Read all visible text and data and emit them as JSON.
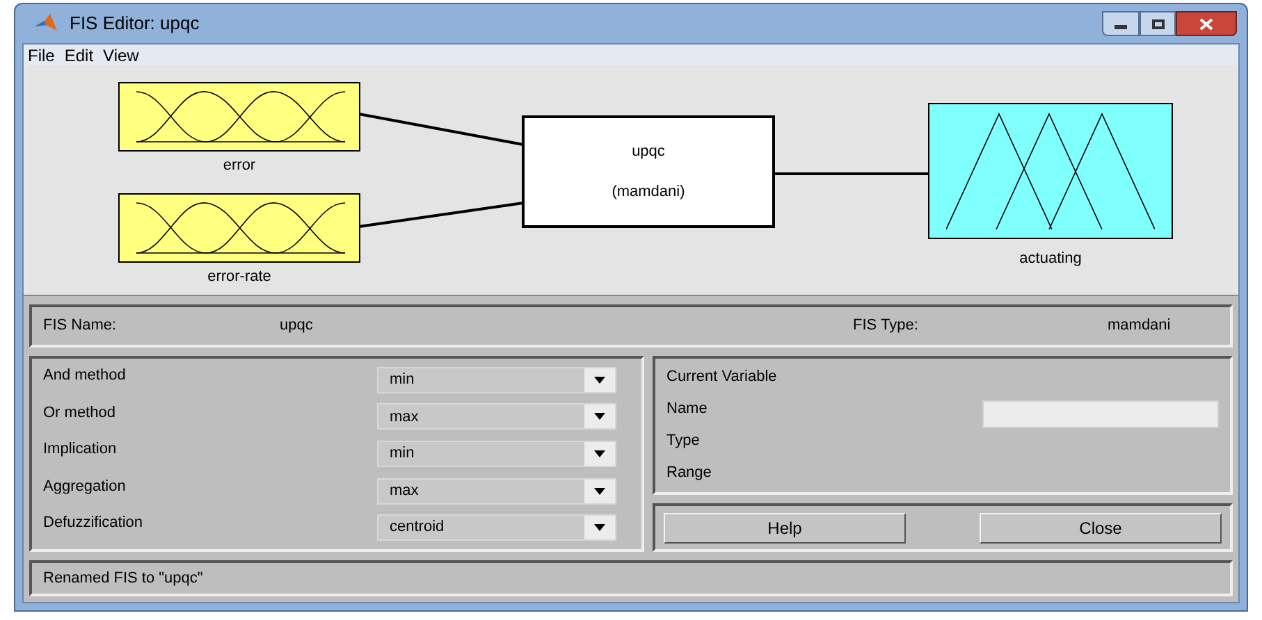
{
  "window": {
    "title": "FIS Editor: upqc"
  },
  "menu": [
    "File",
    "Edit",
    "View"
  ],
  "diagram": {
    "inputs": [
      {
        "label": "error"
      },
      {
        "label": "error-rate"
      }
    ],
    "system": {
      "name": "upqc",
      "type": "(mamdani)"
    },
    "outputs": [
      {
        "label": "actuating"
      }
    ]
  },
  "fis_info": {
    "name_label": "FIS Name:",
    "name": "upqc",
    "type_label": "FIS Type:",
    "type": "mamdani"
  },
  "methods": [
    {
      "label": "And method",
      "value": "min"
    },
    {
      "label": "Or method",
      "value": "max"
    },
    {
      "label": "Implication",
      "value": "min"
    },
    {
      "label": "Aggregation",
      "value": "max"
    },
    {
      "label": "Defuzzification",
      "value": "centroid"
    }
  ],
  "current_variable": {
    "title": "Current Variable",
    "fields": [
      {
        "label": "Name",
        "kind": "input"
      },
      {
        "label": "Type",
        "kind": "text"
      },
      {
        "label": "Range",
        "kind": "text"
      }
    ]
  },
  "buttons": [
    "Help",
    "Close"
  ],
  "status": "Renamed FIS to \"upqc\""
}
